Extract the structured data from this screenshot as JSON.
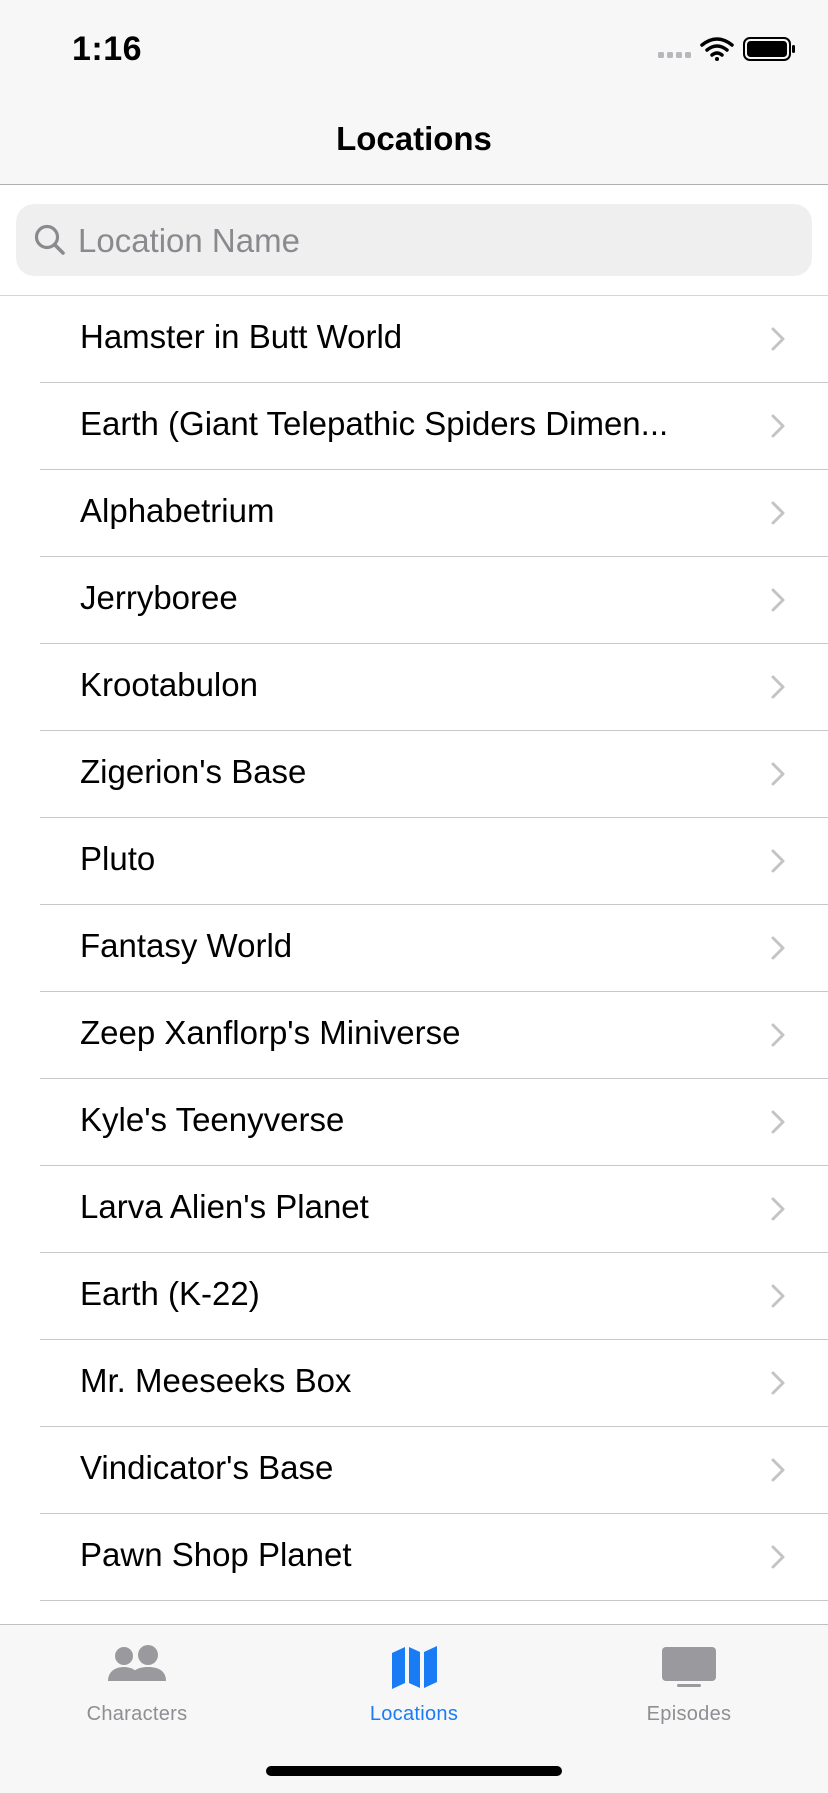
{
  "status_bar": {
    "time": "1:16",
    "icons": [
      "signal-icon",
      "wifi-icon",
      "battery-icon"
    ]
  },
  "nav": {
    "title": "Locations"
  },
  "search": {
    "placeholder": "Location Name",
    "value": ""
  },
  "locations": [
    "Hamster in Butt World",
    "Earth (Giant Telepathic Spiders Dimen...",
    "Alphabetrium",
    "Jerryboree",
    "Krootabulon",
    "Zigerion's Base",
    "Pluto",
    "Fantasy World",
    "Zeep Xanflorp's Miniverse",
    "Kyle's Teenyverse",
    "Larva Alien's Planet",
    "Earth (K-22)",
    "Mr. Meeseeks Box",
    "Vindicator's Base",
    "Pawn Shop Planet"
  ],
  "tabs": [
    {
      "label": "Characters",
      "icon": "people-icon",
      "selected": false
    },
    {
      "label": "Locations",
      "icon": "map-icon",
      "selected": true
    },
    {
      "label": "Episodes",
      "icon": "tv-icon",
      "selected": false
    }
  ],
  "colors": {
    "accent": "#1a7cf5",
    "tab_inactive": "#8e8e93",
    "tab_inactive_icon": "#9a9a9e",
    "chevron": "#c4c4c7",
    "bar_background": "#f7f7f7"
  }
}
